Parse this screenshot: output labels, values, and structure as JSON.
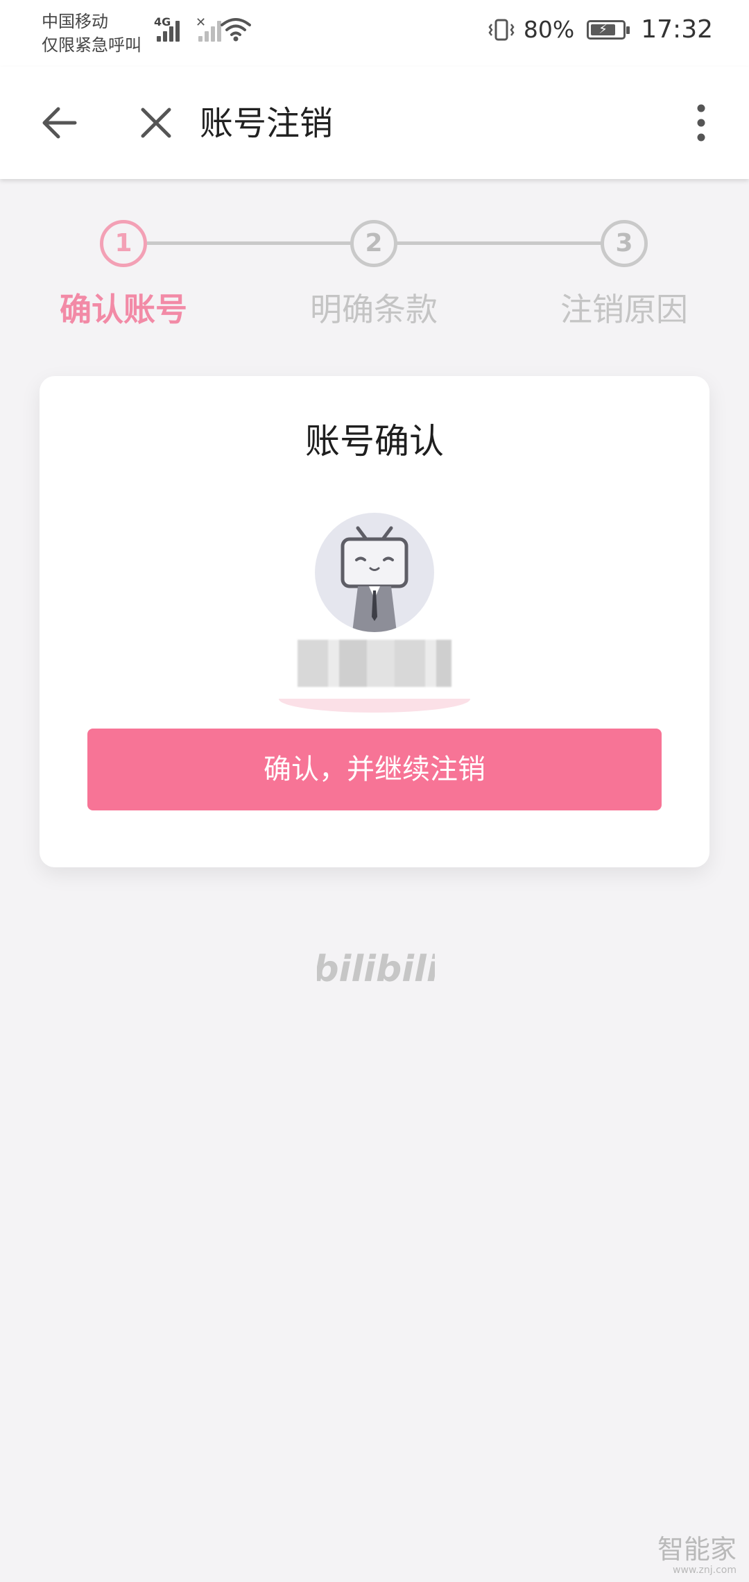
{
  "status_bar": {
    "carrier_line1": "中国移动",
    "carrier_line2": "仅限紧急呼叫",
    "network_tag": "4G",
    "battery_percent": "80%",
    "battery_level": 0.8,
    "time": "17:32"
  },
  "app_bar": {
    "title": "账号注销",
    "back_icon": "arrow-left-icon",
    "close_icon": "close-x-icon",
    "more_icon": "more-vertical-icon"
  },
  "stepper": {
    "active_index": 0,
    "steps": [
      {
        "number": "1",
        "label": "确认账号"
      },
      {
        "number": "2",
        "label": "明确条款"
      },
      {
        "number": "3",
        "label": "注销原因"
      }
    ]
  },
  "card": {
    "title": "账号确认",
    "confirm_button": "确认，并继续注销"
  },
  "footer": {
    "logo_text": "bilibili"
  },
  "watermark": {
    "main": "智能家",
    "url": "www.znj.com"
  },
  "colors": {
    "accent_pink": "#f77496",
    "step_active": "#f28aa6",
    "step_inactive": "#c4c4c4",
    "background": "#f4f3f5"
  }
}
